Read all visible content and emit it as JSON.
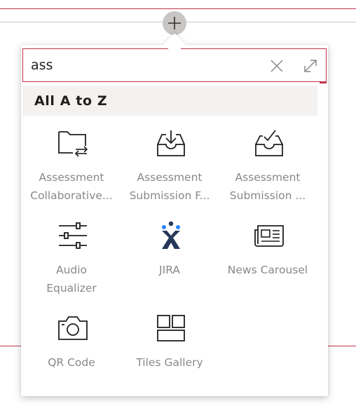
{
  "search": {
    "value": "ass",
    "placeholder": "Search"
  },
  "section": {
    "title": "All A to Z"
  },
  "tiles": [
    {
      "line1": "Assessment",
      "line2": "Collaborative...",
      "icon": "folder-transfer-icon"
    },
    {
      "line1": "Assessment",
      "line2": "Submission F...",
      "icon": "inbox-download-icon"
    },
    {
      "line1": "Assessment",
      "line2": "Submission ...",
      "icon": "inbox-check-icon"
    },
    {
      "line1": "Audio",
      "line2": "Equalizer",
      "icon": "equalizer-icon"
    },
    {
      "line1": "JIRA",
      "line2": "",
      "icon": "jira-logo-icon"
    },
    {
      "line1": "News Carousel",
      "line2": "",
      "icon": "newspaper-icon"
    },
    {
      "line1": "QR Code",
      "line2": "",
      "icon": "camera-icon"
    },
    {
      "line1": "Tiles Gallery",
      "line2": "",
      "icon": "tiles-gallery-icon"
    }
  ],
  "colors": {
    "accent_red": "#c4314b",
    "label_grey": "#8a8886",
    "icon_dark": "#201f1e",
    "jira_blue": "#253858"
  }
}
